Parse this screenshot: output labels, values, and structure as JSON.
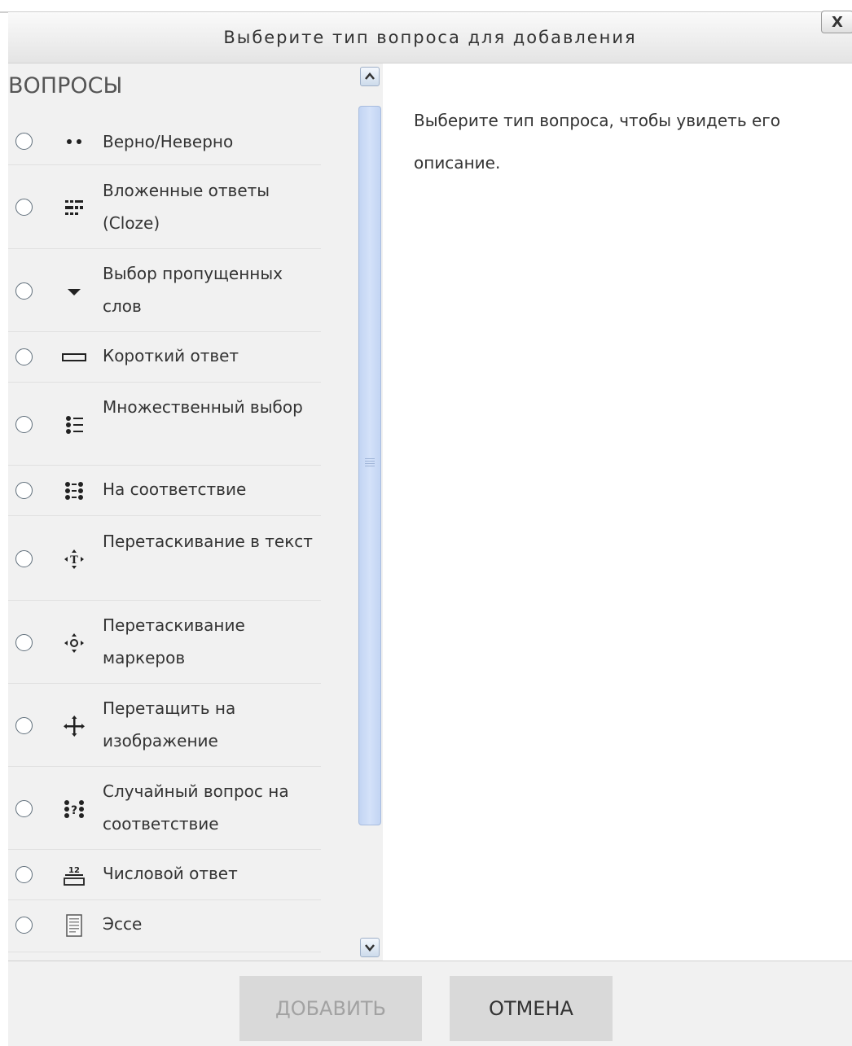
{
  "dialog": {
    "title": "Выберите тип вопроса для добавления",
    "close_label": "X"
  },
  "questions": {
    "heading": "ВОПРОСЫ",
    "items": [
      {
        "label": "Верно/Неверно",
        "icon": "truefalse-icon"
      },
      {
        "label": "Вложенные ответы (Cloze)",
        "icon": "cloze-icon"
      },
      {
        "label": "Выбор пропущенных слов",
        "icon": "dropdown-arrow-icon"
      },
      {
        "label": "Короткий ответ",
        "icon": "shortanswer-icon"
      },
      {
        "label": "Множественный выбор",
        "icon": "multichoice-icon"
      },
      {
        "label": "На соответствие",
        "icon": "match-icon"
      },
      {
        "label": "Перетаскивание в текст",
        "icon": "drag-text-icon"
      },
      {
        "label": "Перетаскивание маркеров",
        "icon": "drag-markers-icon"
      },
      {
        "label": "Перетащить на изображение",
        "icon": "drag-image-icon"
      },
      {
        "label": "Случайный вопрос на соответствие",
        "icon": "random-match-icon"
      },
      {
        "label": "Числовой ответ",
        "icon": "numerical-icon"
      },
      {
        "label": "Эссе",
        "icon": "essay-icon"
      }
    ]
  },
  "description": {
    "text": "Выберите тип вопроса, чтобы увидеть его описание."
  },
  "footer": {
    "add_label": "ДОБАВИТЬ",
    "cancel_label": "ОТМЕНА"
  },
  "colors": {
    "panel_bg": "#f1f1f1",
    "scroll_thumb": "#c9d9f5",
    "disabled_text": "#a2a2a2"
  }
}
